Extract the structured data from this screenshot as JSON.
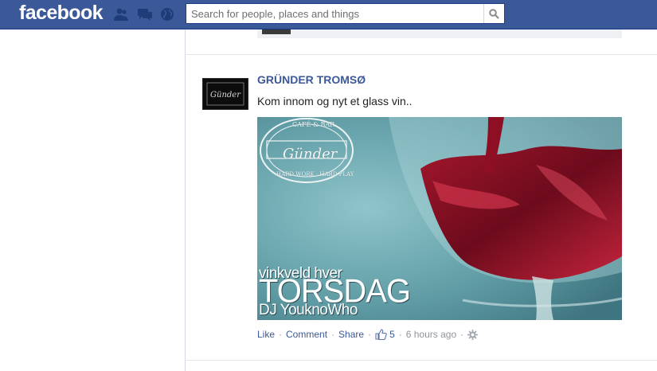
{
  "topbar": {
    "logo": "facebook",
    "search_placeholder": "Search for people, places and things",
    "bg_color": "#3b5998"
  },
  "story": {
    "actor": "GRÜNDER TROMSØ",
    "message": "Kom innom og nyt et glass vin..",
    "photo": {
      "badge_top": "CAFÉ & BAR",
      "badge_name": "Günder",
      "badge_bottom": "HARD WORK · HARD PLAY",
      "line1": "vinkveld hver",
      "line2": "TORSDAG",
      "line3": "DJ YouknoWho"
    },
    "actions": {
      "like": "Like",
      "comment": "Comment",
      "share": "Share",
      "like_count": "5",
      "timestamp": "6 hours ago"
    }
  },
  "icons": {
    "friends": "friend-requests-icon",
    "messages": "messages-icon",
    "notifications": "notifications-globe-icon",
    "search": "magnifier-icon",
    "like": "thumbs-up-icon",
    "settings": "gear-icon"
  }
}
